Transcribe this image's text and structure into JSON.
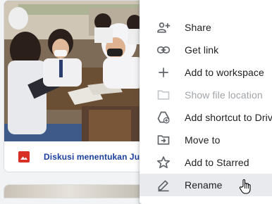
{
  "file_card": {
    "name": "Diskusi menentukan Judul",
    "type_icon": "image-file-icon",
    "type_color": "#d93025"
  },
  "context_menu": {
    "items": [
      {
        "label": "Share",
        "icon": "person-add-icon",
        "enabled": true
      },
      {
        "label": "Get link",
        "icon": "link-icon",
        "enabled": true
      },
      {
        "label": "Add to workspace",
        "icon": "plus-icon",
        "enabled": true
      },
      {
        "label": "Show file location",
        "icon": "folder-icon",
        "enabled": false
      },
      {
        "label": "Add shortcut to Drive",
        "icon": "add-to-drive-icon",
        "enabled": true
      },
      {
        "label": "Move to",
        "icon": "move-to-folder-icon",
        "enabled": true
      },
      {
        "label": "Add to Starred",
        "icon": "star-outline-icon",
        "enabled": true
      },
      {
        "label": "Rename",
        "icon": "pencil-icon",
        "enabled": true,
        "hovered": true
      }
    ]
  },
  "colors": {
    "menu_text": "#202124",
    "disabled_text": "#a0a4a8",
    "hover_bg": "#e8eaed",
    "file_name": "#1a3f9e"
  }
}
